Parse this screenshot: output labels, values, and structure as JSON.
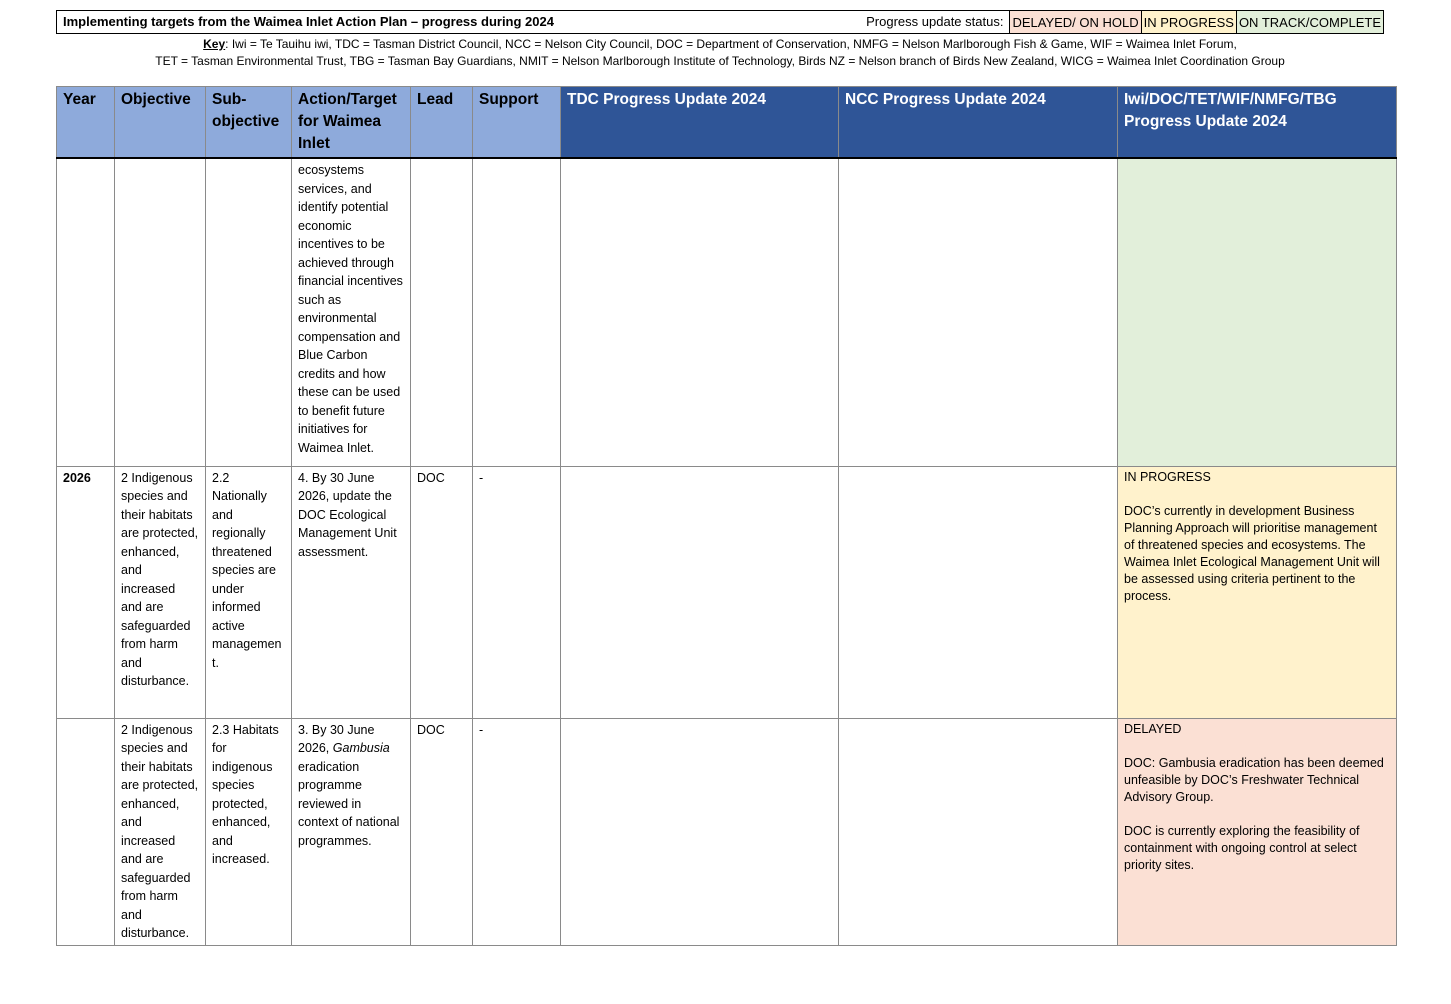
{
  "header": {
    "title": "Implementing targets from the Waimea Inlet Action Plan – progress during 2024",
    "status_label": "Progress update status:",
    "legend": [
      {
        "label": "DELAYED/ ON HOLD",
        "color": "#fbe0d4"
      },
      {
        "label": "IN PROGRESS",
        "color": "#fff2cc"
      },
      {
        "label": "ON TRACK/COMPLETE",
        "color": "#e2efda"
      }
    ]
  },
  "key": {
    "heading": "Key",
    "line1": ": Iwi = Te Tauihu iwi, TDC = Tasman District Council, NCC = Nelson City Council, DOC = Department of Conservation, NMFG = Nelson Marlborough Fish & Game, WIF = Waimea Inlet Forum,",
    "line2": "TET = Tasman Environmental Trust, TBG = Tasman Bay Guardians, NMIT = Nelson Marlborough Institute of Technology, Birds NZ = Nelson branch of Birds New Zealand, WICG = Waimea Inlet Coordination Group"
  },
  "columns": {
    "year": "Year",
    "objective": "Objective",
    "subobjective": "Sub-objective",
    "action": "Action/Target for Waimea Inlet",
    "lead": "Lead",
    "support": "Support",
    "tdc": "TDC Progress Update 2024",
    "ncc": "NCC Progress Update 2024",
    "iwi": "Iwi/DOC/TET/WIF/NMFG/TBG Progress Update 2024"
  },
  "rows": [
    {
      "year": "",
      "objective": "",
      "subobjective": "",
      "action": "ecosystems services, and identify potential economic incentives to be achieved through financial incentives such as environmental compensation and Blue Carbon credits and how these can be used to benefit future initiatives for Waimea Inlet.",
      "lead": "",
      "support": "",
      "tdc": "",
      "ncc": "",
      "iwi_status": "",
      "iwi_p1": "",
      "iwi_p2": ""
    },
    {
      "year": "2026",
      "objective": "2 Indigenous species and their habitats are protected, enhanced, and increased and are safeguarded from harm and disturbance.",
      "subobjective": "2.2 Nationally and regionally threatened species are under informed active managemen t.",
      "action": "4. By 30 June 2026, update the DOC Ecological Management Unit assessment.",
      "lead": "DOC",
      "support": "-",
      "tdc": "",
      "ncc": "",
      "iwi_status": "IN PROGRESS",
      "iwi_p1": "DOC’s currently in development Business Planning Approach will prioritise management of threatened species and ecosystems. The Waimea Inlet Ecological Management Unit will be assessed using criteria pertinent to the process.",
      "iwi_p2": ""
    },
    {
      "year": "",
      "objective": "2 Indigenous species and their habitats are protected, enhanced, and increased and are safeguarded from harm and disturbance.",
      "subobjective": "2.3 Habitats for indigenous species protected, enhanced, and increased.",
      "action_pre": "3. By 30 June 2026, ",
      "action_em": "Gambusia",
      "action_post": " eradication programme reviewed in context of national programmes.",
      "lead": "DOC",
      "support": "-",
      "tdc": "",
      "ncc": "",
      "iwi_status": "DELAYED",
      "iwi_p1": "DOC: Gambusia eradication has been deemed unfeasible by DOC’s Freshwater Technical Advisory Group.",
      "iwi_p2": "DOC is currently exploring the feasibility of containment with ongoing control at select priority sites."
    }
  ]
}
